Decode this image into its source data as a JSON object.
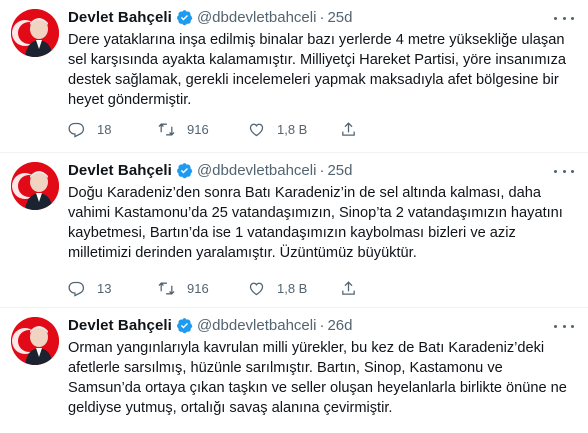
{
  "tweets": [
    {
      "name": "Devlet Bahçeli",
      "handle": "@dbdevletbahceli",
      "dot": "·",
      "time": "25d",
      "text": "Dere yataklarına inşa edilmiş binalar bazı yerlerde 4 metre yüksekliğe ulaşan sel karşısında ayakta kalamamıştır. Milliyetçi Hareket Partisi, yöre insanımıza destek sağlamak, gerekli incelemeleri yapmak maksadıyla afet bölgesine bir heyet göndermiştir.",
      "replies": "18",
      "retweets": "916",
      "likes": "1,8 B"
    },
    {
      "name": "Devlet Bahçeli",
      "handle": "@dbdevletbahceli",
      "dot": "·",
      "time": "25d",
      "text": "Doğu Karadeniz’den sonra Batı Karadeniz’in de sel altında kalması, daha vahimi Kastamonu’da 25 vatandaşımızın, Sinop’ta 2 vatandaşımızın hayatını kaybetmesi, Bartın’da ise 1 vatandaşımızın kaybolması bizleri ve aziz milletimizi derinden yaralamıştır. Üzüntümüz büyüktür.",
      "replies": "13",
      "retweets": "916",
      "likes": "1,8 B"
    },
    {
      "name": "Devlet Bahçeli",
      "handle": "@dbdevletbahceli",
      "dot": "·",
      "time": "26d",
      "text": "Orman yangınlarıyla kavrulan milli yürekler, bu kez de Batı Karadeniz’deki afetlerle sarsılmış, hüzünle sarılmıştır. Bartın, Sinop, Kastamonu ve Samsun’da ortaya çıkan taşkın ve seller oluşan heyelanlarla birlikte önüne ne geldiyse yutmuş, ortalığı savaş alanına çevirmiştir."
    }
  ],
  "colors": {
    "verified": "#1d9bf0",
    "secondary": "#536471",
    "avatar_bg": "#e30a17"
  },
  "icons": [
    "verified-badge-icon",
    "more-icon",
    "reply-icon",
    "retweet-icon",
    "like-icon",
    "share-icon"
  ]
}
